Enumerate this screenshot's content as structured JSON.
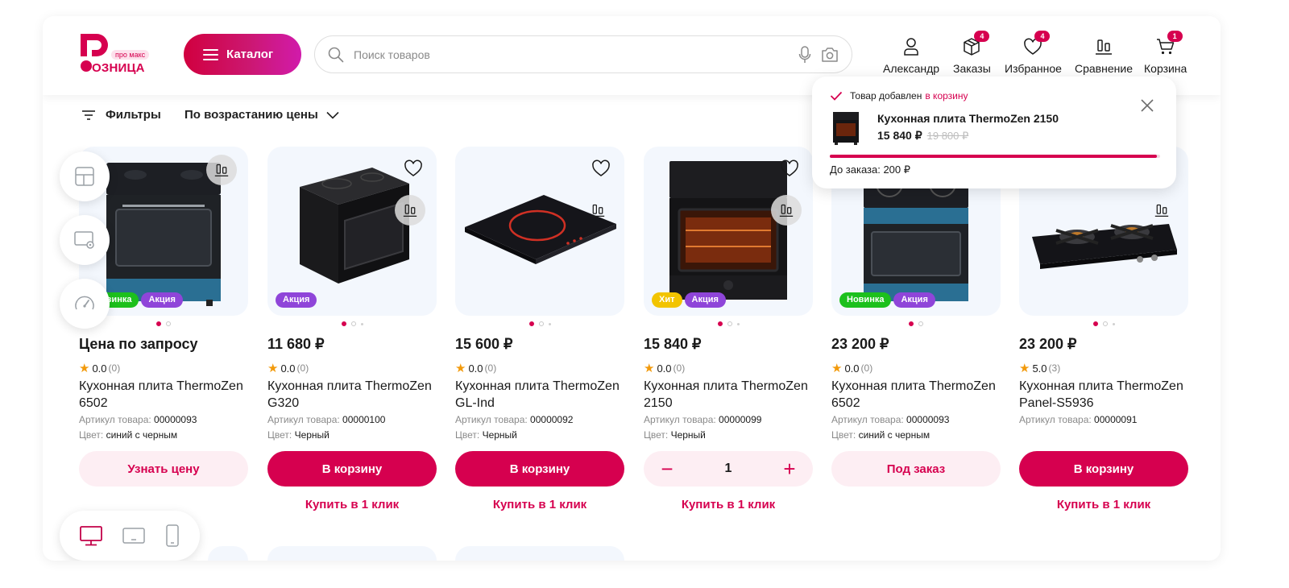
{
  "header": {
    "logo_tag": "про макс",
    "logo_name": "ОЗНИЦА",
    "catalog_label": "Каталог",
    "search_placeholder": "Поиск товаров",
    "nav": [
      {
        "label": "Александр",
        "icon": "user-icon",
        "badge": ""
      },
      {
        "label": "Заказы",
        "icon": "box-icon",
        "badge": "4"
      },
      {
        "label": "Избранное",
        "icon": "heart-icon",
        "badge": "4"
      },
      {
        "label": "Сравнение",
        "icon": "compare-icon",
        "badge": ""
      },
      {
        "label": "Корзина",
        "icon": "cart-icon",
        "badge": "1"
      }
    ]
  },
  "toolbar": {
    "filters_label": "Фильтры",
    "sort_label": "По возрастанию цены"
  },
  "toast": {
    "text": "Товар добавлен",
    "accent": "в корзину",
    "product": "Кухонная плита ThermoZen 2150",
    "price": "15 840 ₽",
    "old_price": "19 800 ₽",
    "progress": 0.99,
    "note": "До заказа: 200 ₽"
  },
  "labels": {
    "sku": "Артикул товара:",
    "color": "Цвет:",
    "one_click": "Купить в 1 клик"
  },
  "colors": {
    "accent": "#d6004f",
    "badge_new": "#1cc01c",
    "badge_sale": "#8f45d9",
    "badge_hit": "#f2c400"
  },
  "products": [
    {
      "price": "Цена по запросу",
      "rating": "0.0",
      "reviews": "(0)",
      "title": "Кухонная плита ThermoZen 6502",
      "sku": "00000093",
      "color": "синий с черным",
      "badges": [
        "Новинка",
        "Акция"
      ],
      "action": "Узнать цену",
      "action_style": "light",
      "one_click": false
    },
    {
      "price": "11 680 ₽",
      "rating": "0.0",
      "reviews": "(0)",
      "title": "Кухонная плита ThermoZen G320",
      "sku": "00000100",
      "color": "Черный",
      "badges": [
        "Акция"
      ],
      "action": "В корзину",
      "action_style": "primary",
      "one_click": true
    },
    {
      "price": "15 600 ₽",
      "rating": "0.0",
      "reviews": "(0)",
      "title": "Кухонная плита ThermoZen GL-Ind",
      "sku": "00000092",
      "color": "Черный",
      "badges": [],
      "action": "В корзину",
      "action_style": "primary",
      "one_click": true
    },
    {
      "price": "15 840 ₽",
      "rating": "0.0",
      "reviews": "(0)",
      "title": "Кухонная плита ThermoZen 2150",
      "sku": "00000099",
      "color": "Черный",
      "badges": [
        "Хит",
        "Акция"
      ],
      "action": "stepper",
      "quantity": "1",
      "action_style": "stepper",
      "one_click": true
    },
    {
      "price": "23 200 ₽",
      "rating": "0.0",
      "reviews": "(0)",
      "title": "Кухонная плита ThermoZen 6502",
      "sku": "00000093",
      "color": "синий с черным",
      "badges": [
        "Новинка",
        "Акция"
      ],
      "action": "Под заказ",
      "action_style": "light",
      "one_click": false
    },
    {
      "price": "23 200 ₽",
      "rating": "5.0",
      "reviews": "(3)",
      "title": "Кухонная плита ThermoZen Panel-S5936",
      "sku": "00000091",
      "color": "",
      "badges": [],
      "action": "В корзину",
      "action_style": "primary",
      "one_click": true
    }
  ]
}
